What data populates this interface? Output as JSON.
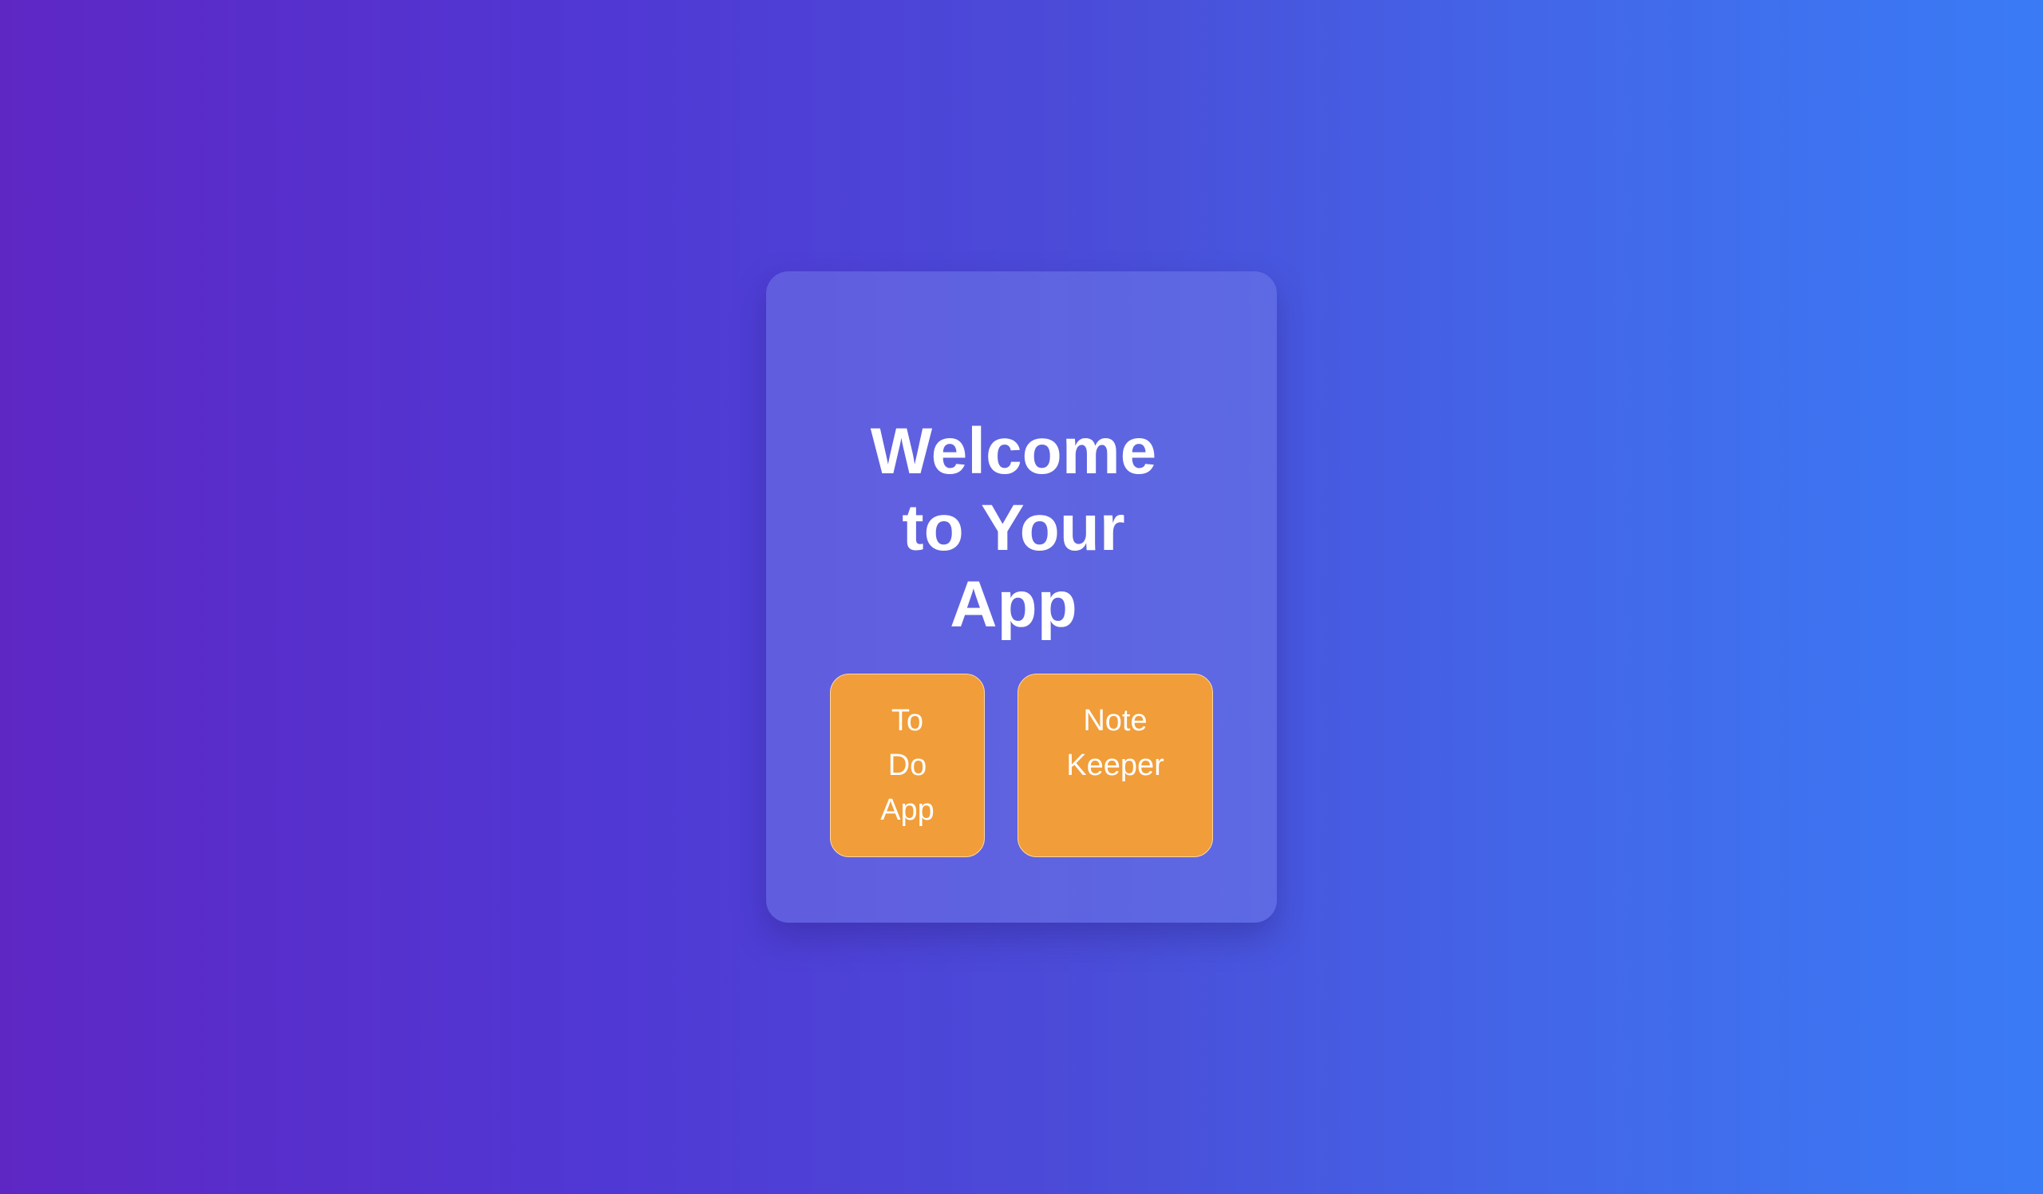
{
  "welcome": {
    "title": "Welcome to Your App"
  },
  "apps": [
    {
      "label": "To Do App"
    },
    {
      "label": "Note Keeper"
    }
  ],
  "colors": {
    "background_start": "#5e27c4",
    "background_end": "#3a7bf5",
    "button": "#f09d3a"
  }
}
